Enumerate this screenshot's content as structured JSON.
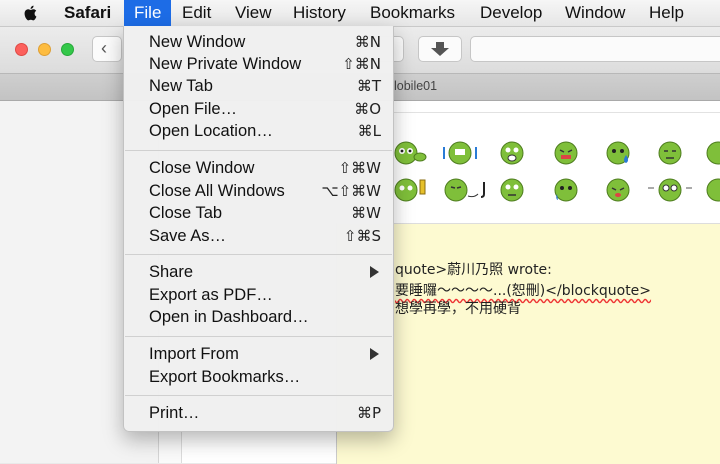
{
  "menubar": {
    "app_name": "Safari",
    "items": [
      "File",
      "Edit",
      "View",
      "History",
      "Bookmarks",
      "Develop",
      "Window",
      "Help"
    ],
    "active_item": "File"
  },
  "tab": {
    "title": "lobile01"
  },
  "post": {
    "lines": [
      "quote>蔚川乃照 wrote:",
      "要睡囉～～～～...(恕刪)</blockquote>",
      "想學再學，不用硬背"
    ]
  },
  "file_menu": {
    "groups": [
      [
        {
          "label": "New Window",
          "shortcut": "⌘N"
        },
        {
          "label": "New Private Window",
          "shortcut": "⇧⌘N"
        },
        {
          "label": "New Tab",
          "shortcut": "⌘T"
        },
        {
          "label": "Open File…",
          "shortcut": "⌘O"
        },
        {
          "label": "Open Location…",
          "shortcut": "⌘L"
        }
      ],
      [
        {
          "label": "Close Window",
          "shortcut": "⇧⌘W"
        },
        {
          "label": "Close All Windows",
          "shortcut": "⌥⇧⌘W"
        },
        {
          "label": "Close Tab",
          "shortcut": "⌘W"
        },
        {
          "label": "Save As…",
          "shortcut": "⇧⌘S"
        }
      ],
      [
        {
          "label": "Share",
          "submenu": true
        },
        {
          "label": "Export as PDF…"
        },
        {
          "label": "Open in Dashboard…"
        }
      ],
      [
        {
          "label": "Import From",
          "submenu": true
        },
        {
          "label": "Export Bookmarks…"
        }
      ],
      [
        {
          "label": "Print…",
          "shortcut": "⌘P"
        }
      ]
    ]
  },
  "colors": {
    "menu_highlight": "#1d6ce6",
    "close": "#fc605c",
    "minimize": "#fdbc40",
    "zoom": "#34c84a",
    "emoji_face": "#7fbf3a",
    "post_background": "#fdfad1"
  }
}
